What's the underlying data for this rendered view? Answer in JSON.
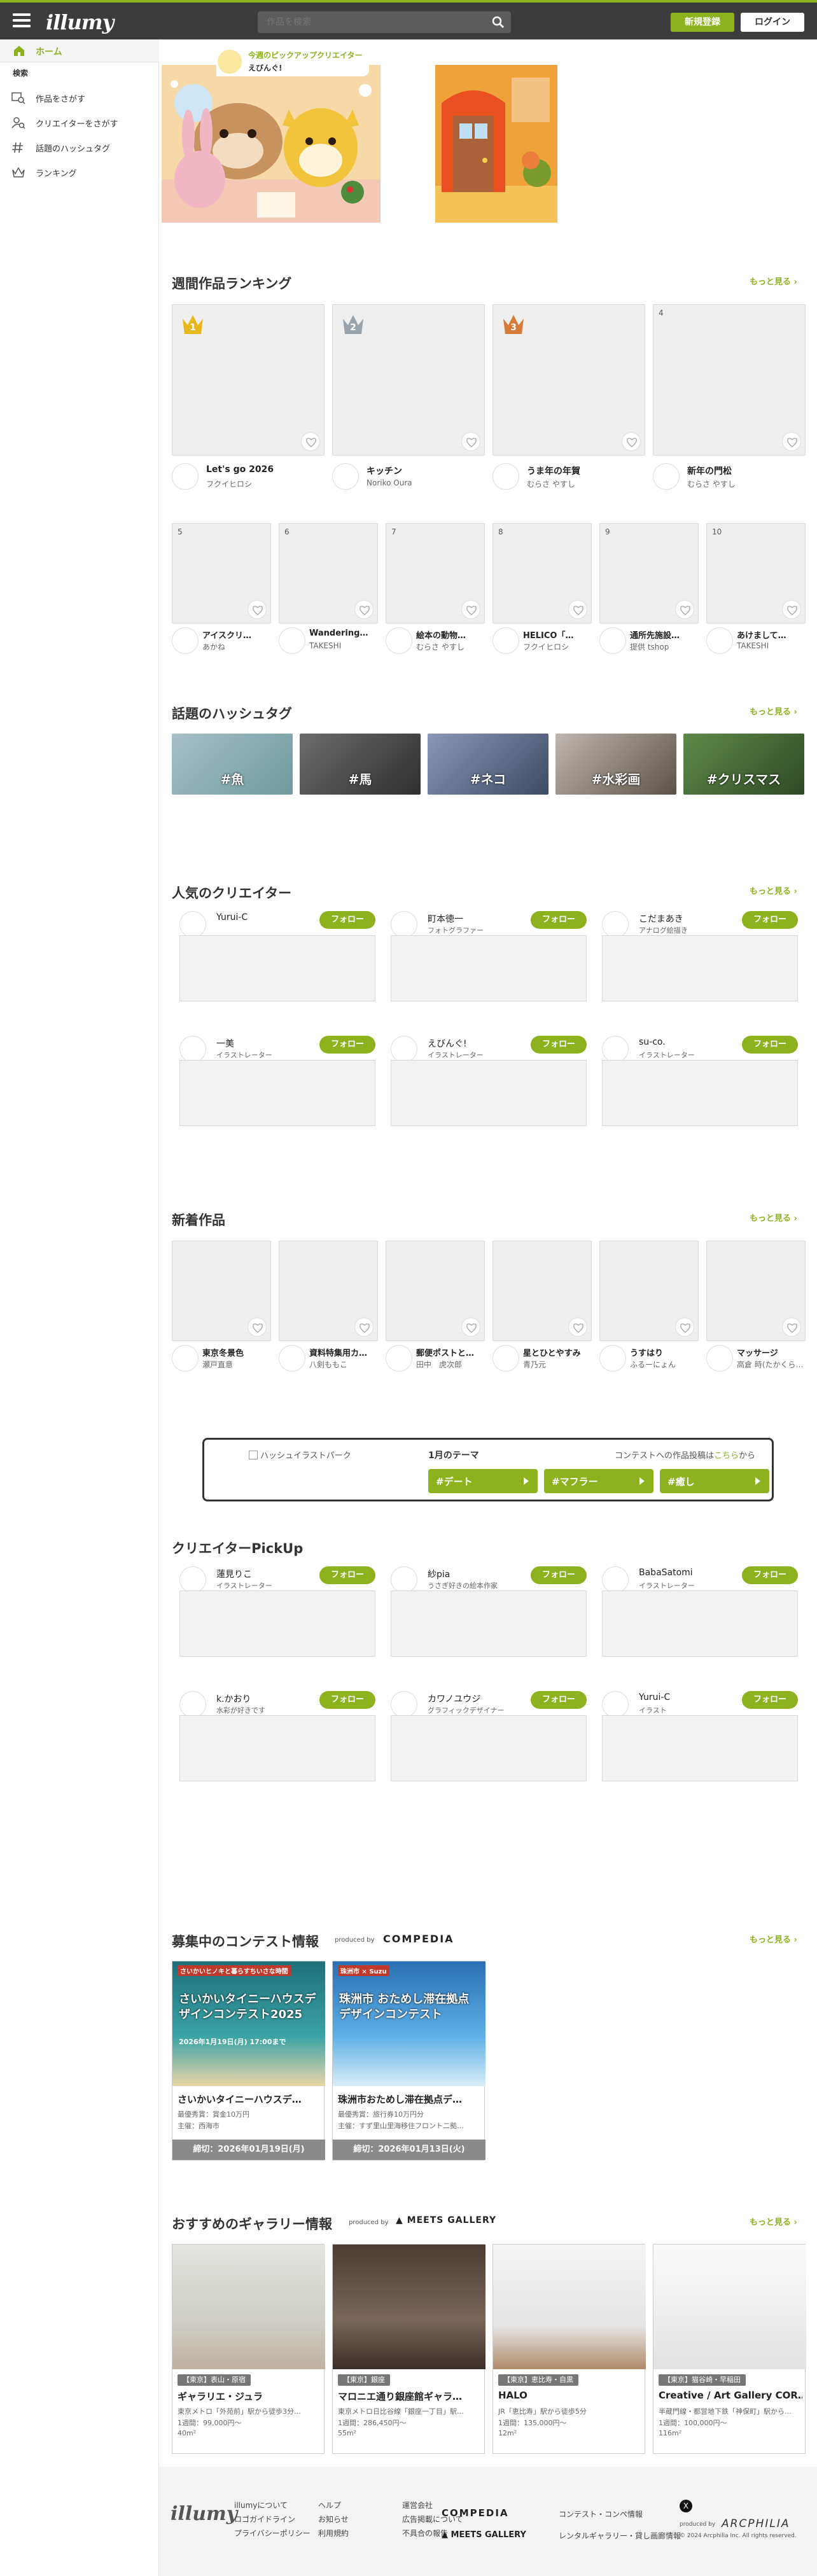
{
  "header": {
    "logo": "illumy",
    "search_placeholder": "作品を検索",
    "register": "新規登録",
    "login": "ログイン"
  },
  "sidebar": {
    "home": "ホーム",
    "section": "検索",
    "items": [
      "作品をさがす",
      "クリエイターをさがす",
      "話題のハッシュタグ",
      "ランキング"
    ]
  },
  "pickup": {
    "label": "今週のピックアップクリエイター",
    "name": "えびんぐ!"
  },
  "ranking": {
    "title": "週間作品ランキング",
    "more": "もっと見る",
    "top": [
      {
        "rank": "1",
        "title": "Let's go 2026",
        "author": "フクイヒロシ"
      },
      {
        "rank": "2",
        "title": "キッチン",
        "author": "Noriko Oura"
      },
      {
        "rank": "3",
        "title": "うま年の年賀",
        "author": "むらさ やすし"
      },
      {
        "rank": "4",
        "title": "新年の門松",
        "author": "むらさ やすし"
      }
    ],
    "rest": [
      {
        "rank": "5",
        "title": "アイスクリ…",
        "author": "あかね"
      },
      {
        "rank": "6",
        "title": "Wandering…",
        "author": "TAKESHI"
      },
      {
        "rank": "7",
        "title": "絵本の動物…",
        "author": "むらさ やすし"
      },
      {
        "rank": "8",
        "title": "HELICO「…",
        "author": "フクイヒロシ"
      },
      {
        "rank": "9",
        "title": "通所先施設…",
        "author": "提供 tshop"
      },
      {
        "rank": "10",
        "title": "あけまして…",
        "author": "TAKESHI"
      }
    ]
  },
  "hashtags": {
    "title": "話題のハッシュタグ",
    "more": "もっと見る",
    "items": [
      "#魚",
      "#馬",
      "#ネコ",
      "#水彩画",
      "#クリスマス"
    ]
  },
  "popular": {
    "title": "人気のクリエイター",
    "more": "もっと見る",
    "follow": "フォロー",
    "items": [
      {
        "name": "Yurui-C",
        "sub": ""
      },
      {
        "name": "町本徳一",
        "sub": "フォトグラファー"
      },
      {
        "name": "こだまあき",
        "sub": "アナログ絵描き"
      },
      {
        "name": "一美",
        "sub": "イラストレーター"
      },
      {
        "name": "えびんぐ!",
        "sub": "イラストレーター"
      },
      {
        "name": "su-co.",
        "sub": "イラストレーター"
      }
    ]
  },
  "newworks": {
    "title": "新着作品",
    "more": "もっと見る",
    "items": [
      {
        "title": "東京冬景色",
        "author": "瀬戸直意"
      },
      {
        "title": "資料特集用カ…",
        "author": "八剣ももこ"
      },
      {
        "title": "郵便ポストと…",
        "author": "田中　虎次郎"
      },
      {
        "title": "星とひとやすみ",
        "author": "青乃元"
      },
      {
        "title": "うすはり",
        "author": "ふるーにょん"
      },
      {
        "title": "マッサージ",
        "author": "高倉 時(たかくら…"
      }
    ]
  },
  "theme": {
    "logo_alt": "ハッシュイラストパーク",
    "label": "1月のテーマ",
    "cta_pre": "コンテストへの作品投稿は",
    "cta_link": "こちら",
    "cta_post": "から",
    "tags": [
      "#デート",
      "#マフラー",
      "#癒し"
    ]
  },
  "pickup_creators": {
    "title": "クリエイターPickUp",
    "follow": "フォロー",
    "items": [
      {
        "name": "蓮見りこ",
        "sub": "イラストレーター"
      },
      {
        "name": "紗pia",
        "sub": "うさぎ好きの絵本作家"
      },
      {
        "name": "BabaSatomi",
        "sub": "イラストレーター"
      },
      {
        "name": "k.かおり",
        "sub": "水彩が好きです"
      },
      {
        "name": "カワノユウジ",
        "sub": "グラフィックデザイナー"
      },
      {
        "name": "Yurui-C",
        "sub": "イラスト"
      }
    ]
  },
  "contests": {
    "title": "募集中のコンテスト情報",
    "produced": "produced by",
    "brand": "COMPEDIA",
    "more": "もっと見る",
    "items": [
      {
        "img_top": "さいかいヒノキと暮らすちいさな時間",
        "img_title": "さいかいタイニーハウスデザインコンテスト2025",
        "img_date": "2026年1月19日(月) 17:00まで",
        "title": "さいかいタイニーハウスデ…",
        "prize": "最優秀賞：賞金10万円",
        "org": "主催：西海市",
        "deadline": "締切：2026年01月19日(月)"
      },
      {
        "img_top": "珠洲市 × Suzu",
        "img_title": "珠洲市 おためし滞在拠点 デザインコンテスト",
        "img_date": "",
        "title": "珠洲市おためし滞在拠点デ…",
        "prize": "最優秀賞：旅行券10万円分",
        "org": "主催：すず里山里海移住フロント二拠…",
        "deadline": "締切：2026年01月13日(火)"
      }
    ]
  },
  "galleries": {
    "title": "おすすめのギャラリー情報",
    "produced": "produced by",
    "brand": "MEETS GALLERY",
    "more": "もっと見る",
    "items": [
      {
        "area": "【東京】表山・原宿",
        "name": "ギャラリエ・ジュラ",
        "access": "東京メトロ「外苑前」駅から徒歩3分…",
        "price": "1週間：99,000円〜",
        "size": "40m²"
      },
      {
        "area": "【東京】銀座",
        "name": "マロニエ通り銀座館ギャラ…",
        "access": "東京メトロ日比谷線「銀座一丁目」駅…",
        "price": "1週間：286,450円〜",
        "size": "55m²"
      },
      {
        "area": "【東京】恵比寿・自黒",
        "name": "HALO",
        "access": "JR「恵比寿」駅から徒歩5分",
        "price": "1週間：135,000円〜",
        "size": "12m²"
      },
      {
        "area": "【東京】猫谷崎・早稲田",
        "name": "Creative / Art Gallery COR…",
        "access": "半蔵門線・都営地下鉄「神保町」駅から…",
        "price": "1週間：100,000円〜",
        "size": "116m²"
      }
    ]
  },
  "footer": {
    "logo": "illumy",
    "links": [
      [
        "illumyについて",
        "ヘルプ",
        "運営会社"
      ],
      [
        "ロゴガイドライン",
        "お知らせ",
        "広告掲載について"
      ],
      [
        "プライバシーポリシー",
        "利用規約",
        "不具合の報告"
      ]
    ],
    "compedia": "COMPEDIA",
    "compedia_desc": "コンテスト・コンペ情報",
    "meets": "MEETS GALLERY",
    "meets_desc": "レンタルギャラリー・貸し画廊情報",
    "produced": "produced by",
    "arcphilia": "ARCPHILIA",
    "copyright": "© 2024 Arcphilia Inc. All rights reserved."
  },
  "colors": {
    "accent": "#8db21d",
    "header": "#3c3c3c"
  }
}
